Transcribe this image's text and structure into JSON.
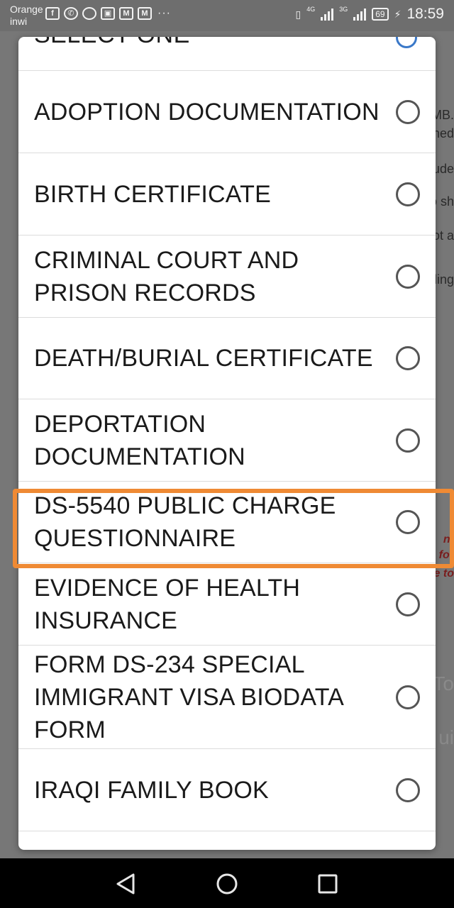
{
  "status_bar": {
    "carrier_line1": "Orange",
    "carrier_line2": "inwi",
    "network_label_1": "4G",
    "network_label_2": "3G",
    "battery": "69",
    "time": "18:59"
  },
  "background": {
    "fragments": [
      "MB.",
      "ned",
      "ude",
      "o sh",
      "ot a",
      "ding",
      "nt",
      "for",
      "e to",
      "To",
      "ui"
    ]
  },
  "dialog": {
    "title": "SELECT ONE",
    "options": [
      {
        "label": "ADOPTION DOCUMENTATION"
      },
      {
        "label": "BIRTH CERTIFICATE"
      },
      {
        "label": "CRIMINAL COURT AND PRISON RECORDS"
      },
      {
        "label": "DEATH/BURIAL CERTIFICATE"
      },
      {
        "label": "DEPORTATION DOCUMENTATION"
      },
      {
        "label": "DS-5540 PUBLIC CHARGE QUESTIONNAIRE"
      },
      {
        "label": "EVIDENCE OF HEALTH INSURANCE"
      },
      {
        "label": "FORM DS-234 SPECIAL IMMIGRANT VISA BIODATA FORM"
      },
      {
        "label": "IRAQI FAMILY BOOK"
      }
    ]
  },
  "colors": {
    "highlight": "#ef8a34",
    "selected_radio": "#3a78c8"
  },
  "icons": {
    "nav": [
      "back-triangle-icon",
      "home-circle-icon",
      "recent-square-icon"
    ]
  }
}
